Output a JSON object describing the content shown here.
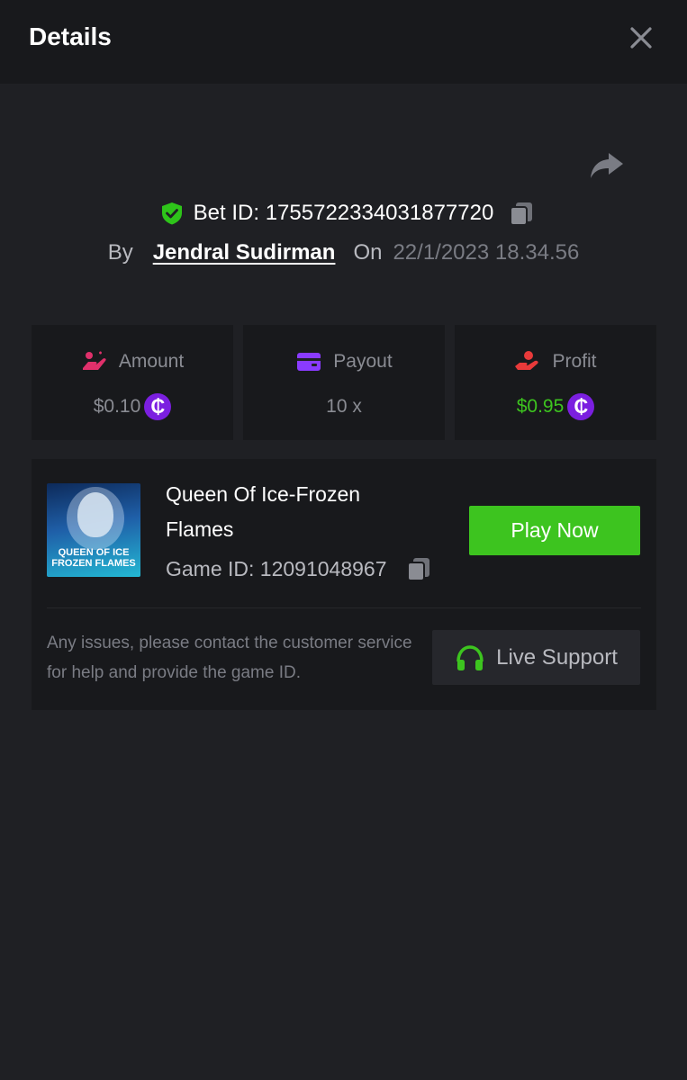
{
  "header": {
    "title": "Details",
    "close_icon": "close-icon"
  },
  "bet": {
    "label": "Bet ID: 1755722334031877720",
    "by_label": "By",
    "user": "Jendral Sudirman",
    "on_label": "On",
    "datetime": "22/1/2023 18.34.56"
  },
  "stats": {
    "amount": {
      "label": "Amount",
      "value": "$0.10",
      "icon": "hand-coin-icon"
    },
    "payout": {
      "label": "Payout",
      "value": "10 x",
      "icon": "wallet-icon"
    },
    "profit": {
      "label": "Profit",
      "value": "$0.95",
      "icon": "hand-money-icon"
    },
    "coin_symbol": "₵"
  },
  "game": {
    "name": "Queen Of Ice-Frozen Flames",
    "thumb_line1": "QUEEN OF ICE",
    "thumb_line2": "FROZEN FLAMES",
    "game_id": "Game ID: 12091048967",
    "play_label": "Play Now"
  },
  "support": {
    "help_text": "Any issues, please contact the customer service for help and provide the game ID.",
    "button_label": "Live Support"
  },
  "colors": {
    "background": "#1f2024",
    "card": "#18191c",
    "accent_green": "#3dc41f",
    "profit_green": "#3dc41f",
    "coin_purple": "#7b1fe0",
    "amount_pink": "#e0306b",
    "payout_purple": "#8a3bff",
    "profit_red": "#e83a3a"
  }
}
